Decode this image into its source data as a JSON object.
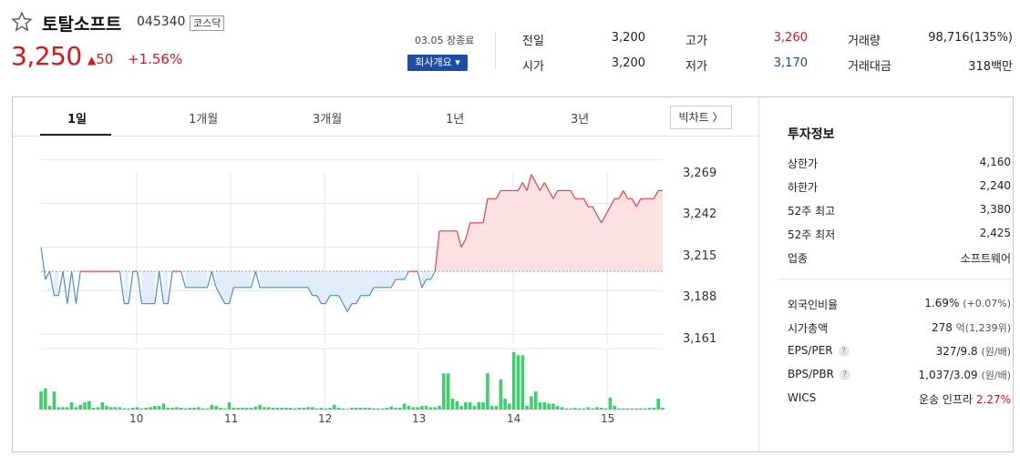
{
  "stock": {
    "name": "토탈소프트",
    "code": "045340",
    "market": "코스닥",
    "price": "3,250",
    "change": "50",
    "change_symbol": "▲",
    "rate": "+1.56%",
    "date_status": "03.05 장종료",
    "company_button": "회사개요 ▾"
  },
  "quotes": [
    {
      "label": "전일",
      "value": "3,200"
    },
    {
      "label": "고가",
      "value": "3,260",
      "tone": "red"
    },
    {
      "label": "거래량",
      "value": "98,716(135%)"
    },
    {
      "label": "시가",
      "value": "3,200"
    },
    {
      "label": "저가",
      "value": "3,170",
      "tone": "blue"
    },
    {
      "label": "거래대금",
      "value": "318백만"
    }
  ],
  "tabs": [
    "1일",
    "1개월",
    "3개월",
    "1년",
    "3년"
  ],
  "active_tab": "1일",
  "big_chart_button": "빅차트 〉",
  "invest": {
    "title": "투자정보",
    "rows1": [
      {
        "label": "상한가",
        "value": "4,160",
        "tone": "red"
      },
      {
        "label": "하한가",
        "value": "2,240",
        "tone": "blue"
      },
      {
        "label": "52주 최고",
        "value": "3,380"
      },
      {
        "label": "52주 최저",
        "value": "2,425"
      },
      {
        "label": "업종",
        "value": "소프트웨어"
      }
    ],
    "foreign_label": "외국인비율",
    "foreign_value": "1.69%",
    "foreign_sub": "(+0.07%)",
    "cap_label": "시가총액",
    "cap_value": "278",
    "cap_sub": "억(1,239위)",
    "eps_label": "EPS/PER",
    "eps_value": "327/9.8",
    "eps_sub": "(원/배)",
    "bps_label": "BPS/PBR",
    "bps_value": "1,037/3.09",
    "bps_sub": "(원/배)",
    "wics_label": "WICS",
    "wics_value": "운송 인프라",
    "wics_rate": "2.27%"
  },
  "colors": {
    "up": "#e3121a",
    "down": "#1a45c4",
    "line_up": "#e8323a",
    "line_down": "#3d86d4",
    "fill_up": "#fde0e2",
    "fill_down": "#e2edf9",
    "volume": "#3dcf6a"
  },
  "chart_data": {
    "type": "line",
    "baseline": 3200,
    "ylim": [
      3155,
      3275
    ],
    "yticks": [
      "3,269",
      "3,242",
      "3,215",
      "3,188",
      "3,161"
    ],
    "xticks": [
      "10",
      "11",
      "12",
      "13",
      "14",
      "15"
    ],
    "prices": [
      3215,
      3195,
      3200,
      3185,
      3185,
      3200,
      3180,
      3200,
      3180,
      3200,
      3200,
      3200,
      3200,
      3200,
      3200,
      3200,
      3200,
      3200,
      3200,
      3180,
      3180,
      3200,
      3200,
      3180,
      3180,
      3180,
      3180,
      3200,
      3180,
      3180,
      3200,
      3200,
      3200,
      3190,
      3190,
      3190,
      3190,
      3190,
      3190,
      3200,
      3190,
      3185,
      3180,
      3180,
      3190,
      3190,
      3190,
      3190,
      3190,
      3200,
      3190,
      3190,
      3190,
      3190,
      3190,
      3190,
      3190,
      3190,
      3190,
      3190,
      3190,
      3190,
      3185,
      3185,
      3180,
      3180,
      3185,
      3185,
      3185,
      3180,
      3175,
      3180,
      3180,
      3185,
      3185,
      3185,
      3190,
      3190,
      3190,
      3190,
      3190,
      3195,
      3195,
      3195,
      3200,
      3200,
      3200,
      3190,
      3195,
      3195,
      3200,
      3225,
      3225,
      3225,
      3225,
      3225,
      3215,
      3220,
      3230,
      3230,
      3230,
      3230,
      3245,
      3245,
      3245,
      3250,
      3250,
      3250,
      3250,
      3250,
      3255,
      3250,
      3260,
      3255,
      3250,
      3255,
      3250,
      3245,
      3250,
      3250,
      3250,
      3250,
      3245,
      3245,
      3245,
      3240,
      3240,
      3235,
      3230,
      3235,
      3240,
      3245,
      3245,
      3250,
      3245,
      3245,
      3240,
      3245,
      3245,
      3245,
      3245,
      3250,
      3250
    ],
    "volumes": [
      30,
      35,
      6,
      30,
      4,
      4,
      4,
      12,
      4,
      8,
      12,
      14,
      3,
      4,
      12,
      6,
      4,
      4,
      4,
      2,
      2,
      3,
      4,
      2,
      3,
      4,
      6,
      6,
      10,
      3,
      3,
      4,
      3,
      2,
      3,
      3,
      4,
      2,
      2,
      8,
      6,
      3,
      2,
      12,
      3,
      3,
      3,
      3,
      3,
      5,
      8,
      4,
      4,
      3,
      3,
      3,
      3,
      3,
      2,
      3,
      3,
      4,
      4,
      2,
      3,
      2,
      3,
      8,
      3,
      2,
      1,
      3,
      3,
      3,
      3,
      3,
      2,
      2,
      2,
      3,
      5,
      3,
      3,
      10,
      6,
      4,
      4,
      6,
      6,
      4,
      4,
      6,
      60,
      60,
      18,
      14,
      6,
      12,
      12,
      6,
      12,
      12,
      60,
      6,
      6,
      50,
      18,
      10,
      95,
      90,
      90,
      6,
      22,
      30,
      12,
      12,
      10,
      10,
      6,
      4,
      2,
      2,
      3,
      2,
      2,
      4,
      2,
      4,
      3,
      2,
      20,
      6,
      2,
      2,
      2,
      2,
      2,
      2,
      2,
      3,
      3,
      18,
      3
    ]
  }
}
